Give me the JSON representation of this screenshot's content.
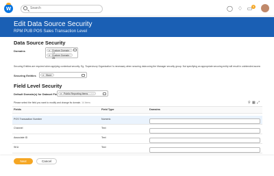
{
  "search": {
    "placeholder": "Search"
  },
  "notifications": {
    "count": "9"
  },
  "header": {
    "title": "Edit Data Source Security",
    "subtitle": "RPM PUB POS Sales Transaction Level"
  },
  "data_source_security": {
    "heading": "Data Source Security",
    "domains_label": "Domains",
    "domain_items": [
      "Custom Domain 1A",
      "Custom Domain 2B"
    ],
    "note": "Securing Entities are required when applying contextual security. Eg. 'Supervisory Organization' is necessary when securing data using the Manager security group. Not specifying an appropriate securing entity will result in unintended access to the data.",
    "securing_entities_label": "Securing Entities",
    "securing_entity_item": "Store"
  },
  "field_level_security": {
    "heading": "Field Level Security",
    "default_label": "Default Domain(s) for Dataset Fields",
    "default_item": "Public Reporting Items",
    "instruction": "Please select the field you want to modify and change its domain.",
    "items_count": "14 items",
    "columns": [
      "Fields",
      "Field Type",
      "Domains"
    ],
    "rows": [
      {
        "field": "POS Transaction Number",
        "type": "Numeric"
      },
      {
        "field": "Channel",
        "type": "Text"
      },
      {
        "field": "Associate ID",
        "type": "Text"
      },
      {
        "field": "SKU",
        "type": "Text"
      }
    ]
  },
  "footer": {
    "ok_label": "Next",
    "cancel_label": "Cancel"
  }
}
